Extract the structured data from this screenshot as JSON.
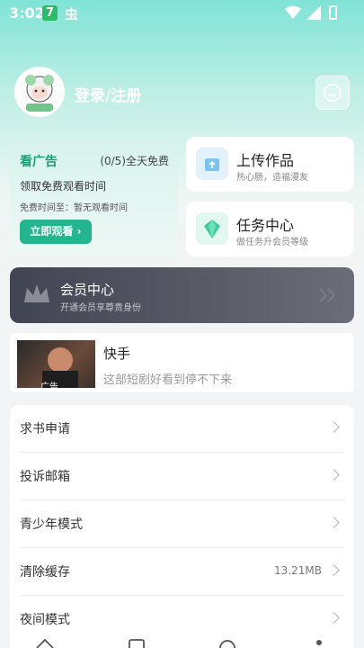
{
  "status": {
    "time": "3:02",
    "badge": "7",
    "bug_icon": "虫"
  },
  "header": {
    "login_label": "登录/注册",
    "avatar_tag": "小肥羊"
  },
  "ad_card": {
    "title": "看广告",
    "count": "(0/5)全天免费",
    "subtitle": "领取免费观看时间",
    "free_time": "免费时间至：暂无观看时间",
    "button_label": "立即观看",
    "button_arrow": "›"
  },
  "upload_card": {
    "title": "上传作品",
    "subtitle": "热心肠，造福漫友"
  },
  "task_card": {
    "title": "任务中心",
    "subtitle": "做任务升会员等级"
  },
  "vip": {
    "title": "会员中心",
    "subtitle": "开通会员享尊贵身份"
  },
  "ad_row": {
    "tag": "广告",
    "name": "快手",
    "desc": "这部短剧好看到停不下来"
  },
  "menu": {
    "items": [
      {
        "label": "求书申请",
        "value": ""
      },
      {
        "label": "投诉邮箱",
        "value": ""
      },
      {
        "label": "青少年模式",
        "value": ""
      },
      {
        "label": "清除缓存",
        "value": "13.21MB"
      },
      {
        "label": "夜间模式",
        "value": ""
      }
    ]
  },
  "colors": {
    "accent": "#24b58e",
    "vip_bg": "#414452"
  }
}
